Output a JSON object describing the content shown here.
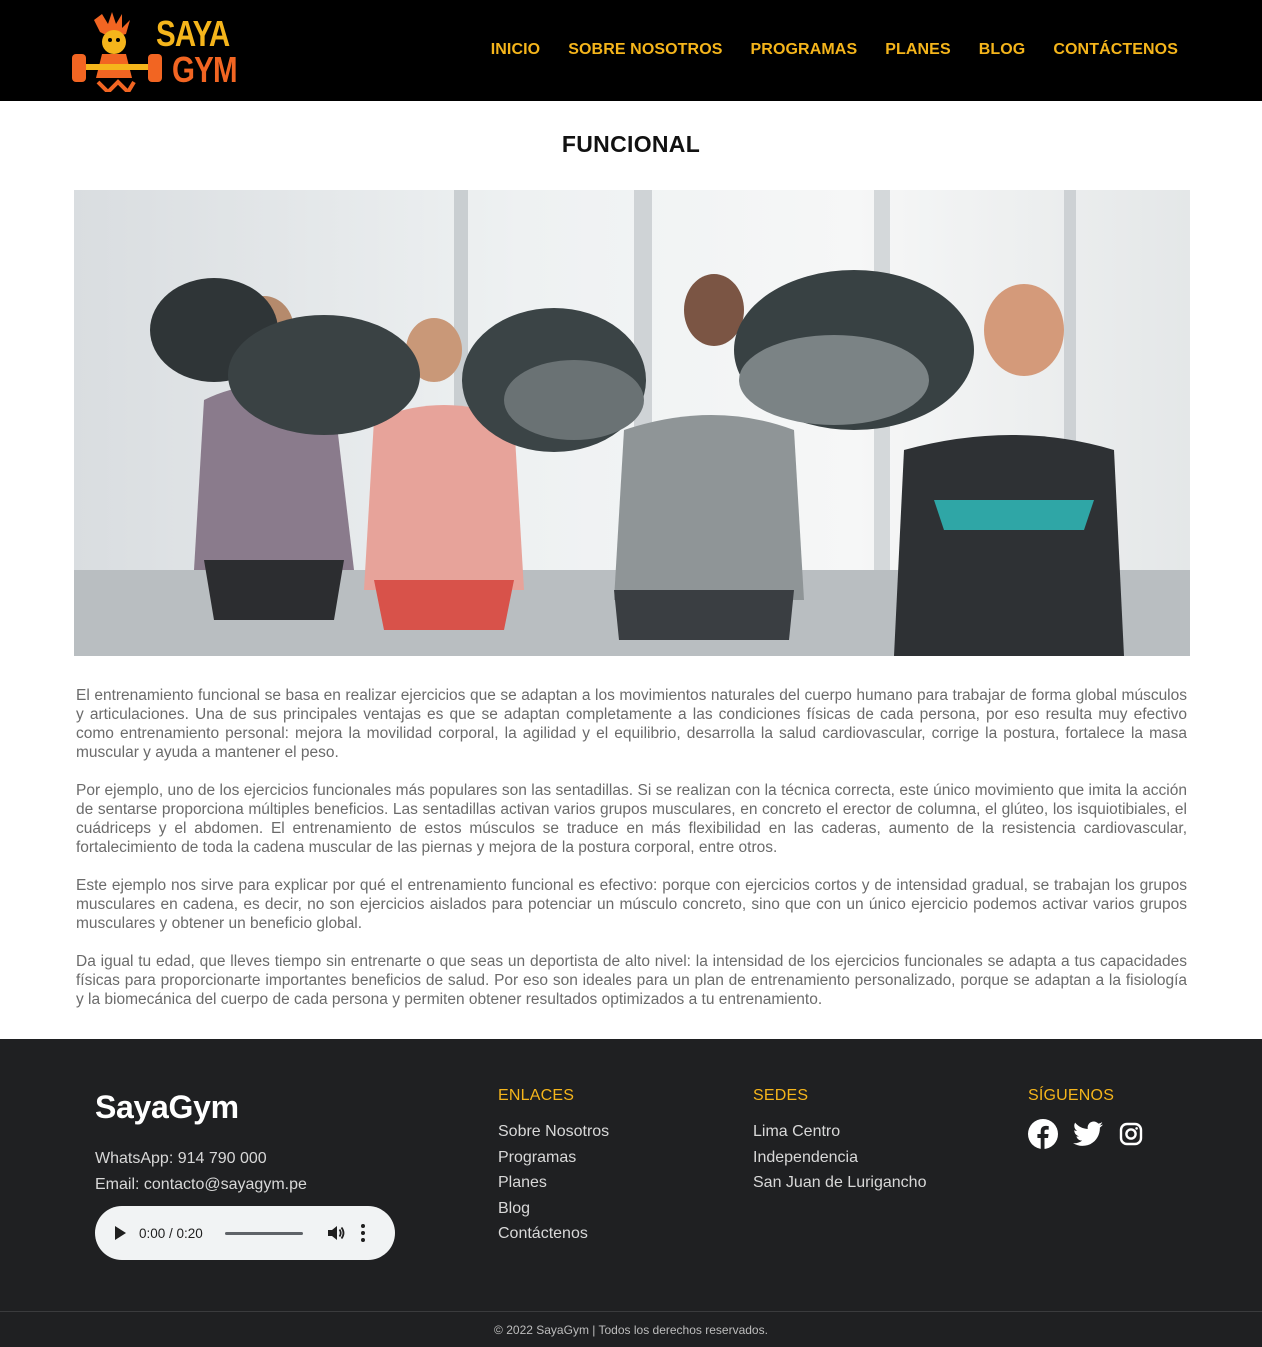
{
  "header": {
    "logo_alt": "SayaGym logo",
    "logo_line1": "SAYA",
    "logo_line2": "GYM",
    "nav": [
      {
        "label": "INICIO"
      },
      {
        "label": "SOBRE NOSOTROS"
      },
      {
        "label": "PROGRAMAS"
      },
      {
        "label": "PLANES"
      },
      {
        "label": "BLOG"
      },
      {
        "label": "CONTÁCTENOS"
      }
    ]
  },
  "main": {
    "title": "FUNCIONAL",
    "hero_alt": "Group training with medicine balls",
    "paragraphs": [
      "El entrenamiento funcional se basa en realizar ejercicios que se adaptan a los movimientos naturales del cuerpo humano para trabajar de forma global músculos y articulaciones. Una de sus principales ventajas es que se adaptan completamente a las condiciones físicas de cada persona, por eso resulta muy efectivo como entrenamiento personal: mejora la movilidad corporal, la agilidad y el equilibrio, desarrolla la salud cardiovascular, corrige la postura, fortalece la masa muscular y ayuda a mantener el peso.",
      "Por ejemplo, uno de los ejercicios funcionales más populares son las sentadillas. Si se realizan con la técnica correcta, este único movimiento que imita la acción de sentarse proporciona múltiples beneficios. Las sentadillas activan varios grupos musculares, en concreto el erector de columna, el glúteo, los isquiotibiales, el cuádriceps y el abdomen. El entrenamiento de estos músculos se traduce en más flexibilidad en las caderas, aumento de la resistencia cardiovascular, fortalecimiento de toda la cadena muscular de las piernas y mejora de la postura corporal, entre otros.",
      "Este ejemplo nos sirve para explicar por qué el entrenamiento funcional es efectivo: porque con ejercicios cortos y de intensidad gradual, se trabajan los grupos musculares en cadena, es decir, no son ejercicios aislados para potenciar un músculo concreto, sino que con un único ejercicio podemos activar varios grupos musculares y obtener un beneficio global.",
      "Da igual tu edad, que lleves tiempo sin entrenarte o que seas un deportista de alto nivel: la intensidad de los ejercicios funcionales se adapta a tus capacidades físicas para proporcionarte importantes beneficios de salud. Por eso son ideales para un plan de entrenamiento personalizado, porque se adaptan a la fisiología y la biomecánica del cuerpo de cada persona y permiten obtener resultados optimizados a tu entrenamiento."
    ]
  },
  "footer": {
    "brand": "SayaGym",
    "whatsapp": "WhatsApp: 914 790 000",
    "email": "Email: contacto@sayagym.pe",
    "audio": {
      "time": "0:00 / 0:20"
    },
    "enlaces": {
      "heading": "ENLACES",
      "items": [
        "Sobre Nosotros",
        "Programas",
        "Planes",
        "Blog",
        "Contáctenos"
      ]
    },
    "sedes": {
      "heading": "SEDES",
      "items": [
        "Lima Centro",
        "Independencia",
        "San Juan de Lurigancho"
      ]
    },
    "siguenos": {
      "heading": "SÍGUENOS",
      "icons": [
        "facebook-icon",
        "twitter-icon",
        "instagram-icon"
      ]
    },
    "copyright": "© 2022 SayaGym | Todos los derechos reservados."
  },
  "colors": {
    "accent": "#f5b51b",
    "accent_orange": "#f26522",
    "header_bg": "#000000",
    "footer_bg": "#1f2022"
  }
}
